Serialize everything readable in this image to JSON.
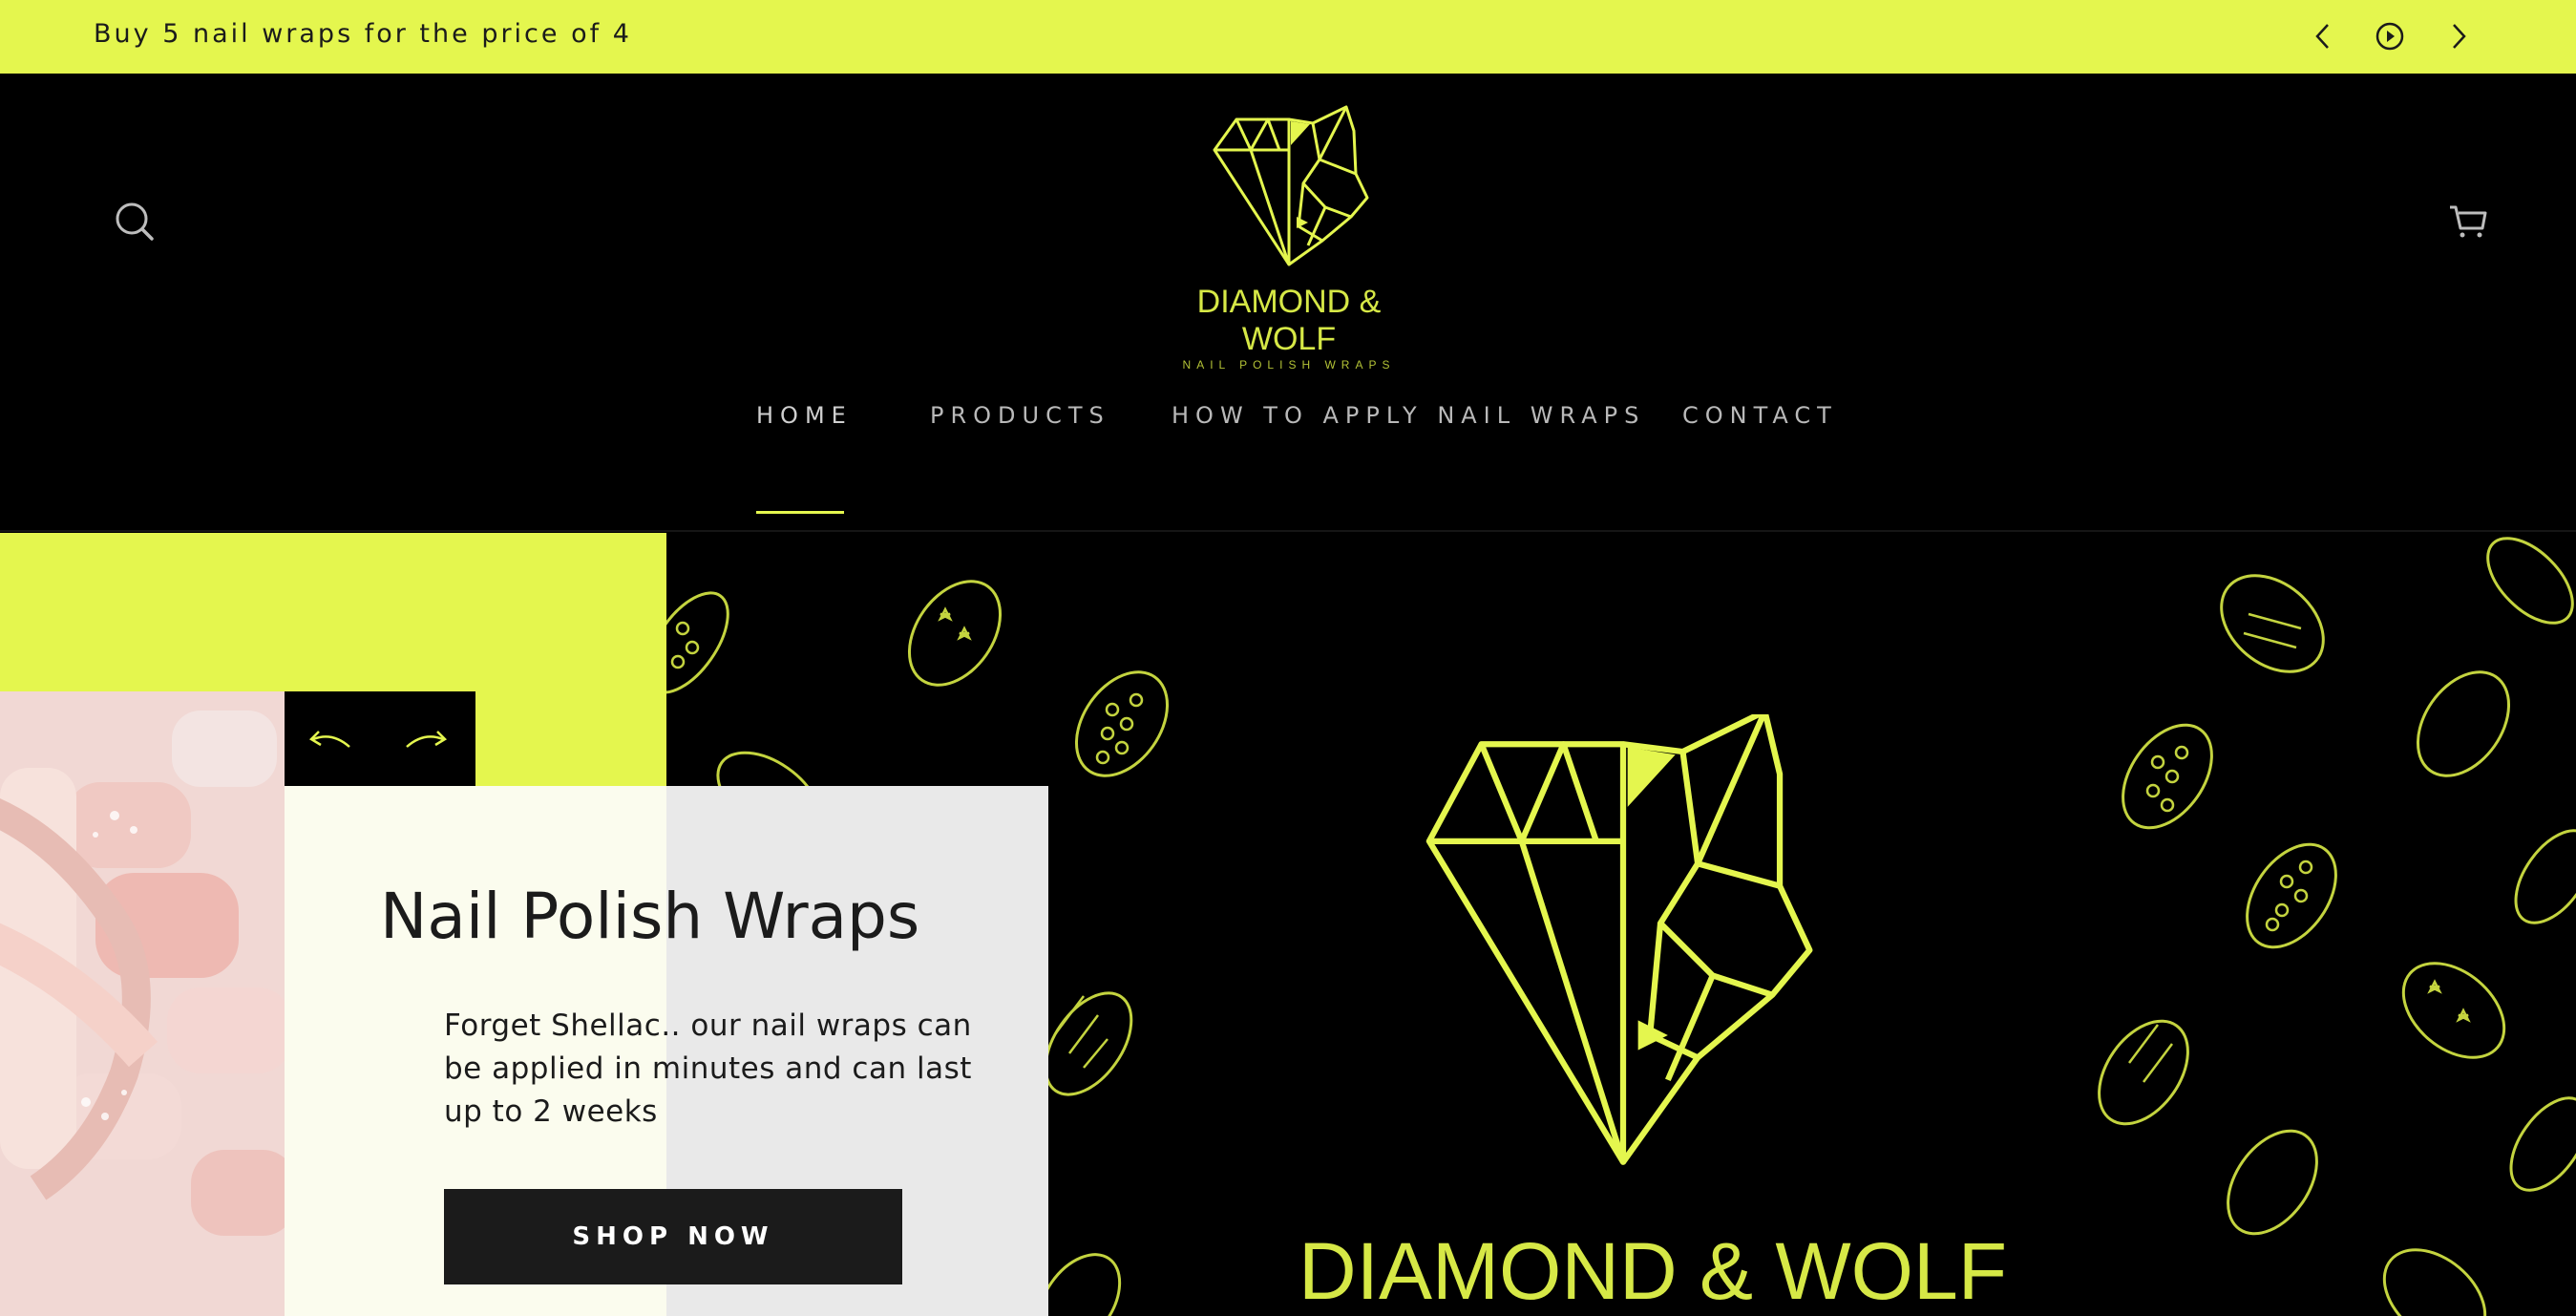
{
  "announcement": {
    "text": "Buy 5 nail wraps for the price of 4",
    "prev_icon": "chevron-left-icon",
    "pause_icon": "pause-play-icon",
    "next_icon": "chevron-right-icon"
  },
  "header": {
    "search_icon": "search-icon",
    "cart_icon": "cart-icon",
    "logo": {
      "title": "DIAMOND & WOLF",
      "subtitle": "NAIL POLISH WRAPS"
    },
    "nav": [
      {
        "label": "HOME",
        "active": true
      },
      {
        "label": "PRODUCTS",
        "active": false
      },
      {
        "label": "HOW TO APPLY NAIL WRAPS",
        "active": false
      },
      {
        "label": "CONTACT",
        "active": false
      }
    ]
  },
  "hero": {
    "title": "Nail Polish Wraps",
    "description": "Forget Shellac.. our nail wraps can be applied in minutes and can last up to 2 weeks",
    "button": "SHOP NOW",
    "brand": "DIAMOND & WOLF",
    "prev_icon": "curved-arrow-left-icon",
    "next_icon": "curved-arrow-right-icon"
  },
  "colors": {
    "accent": "#e4f64e",
    "dark": "#1b1b1b",
    "card": "#fbfcee"
  }
}
